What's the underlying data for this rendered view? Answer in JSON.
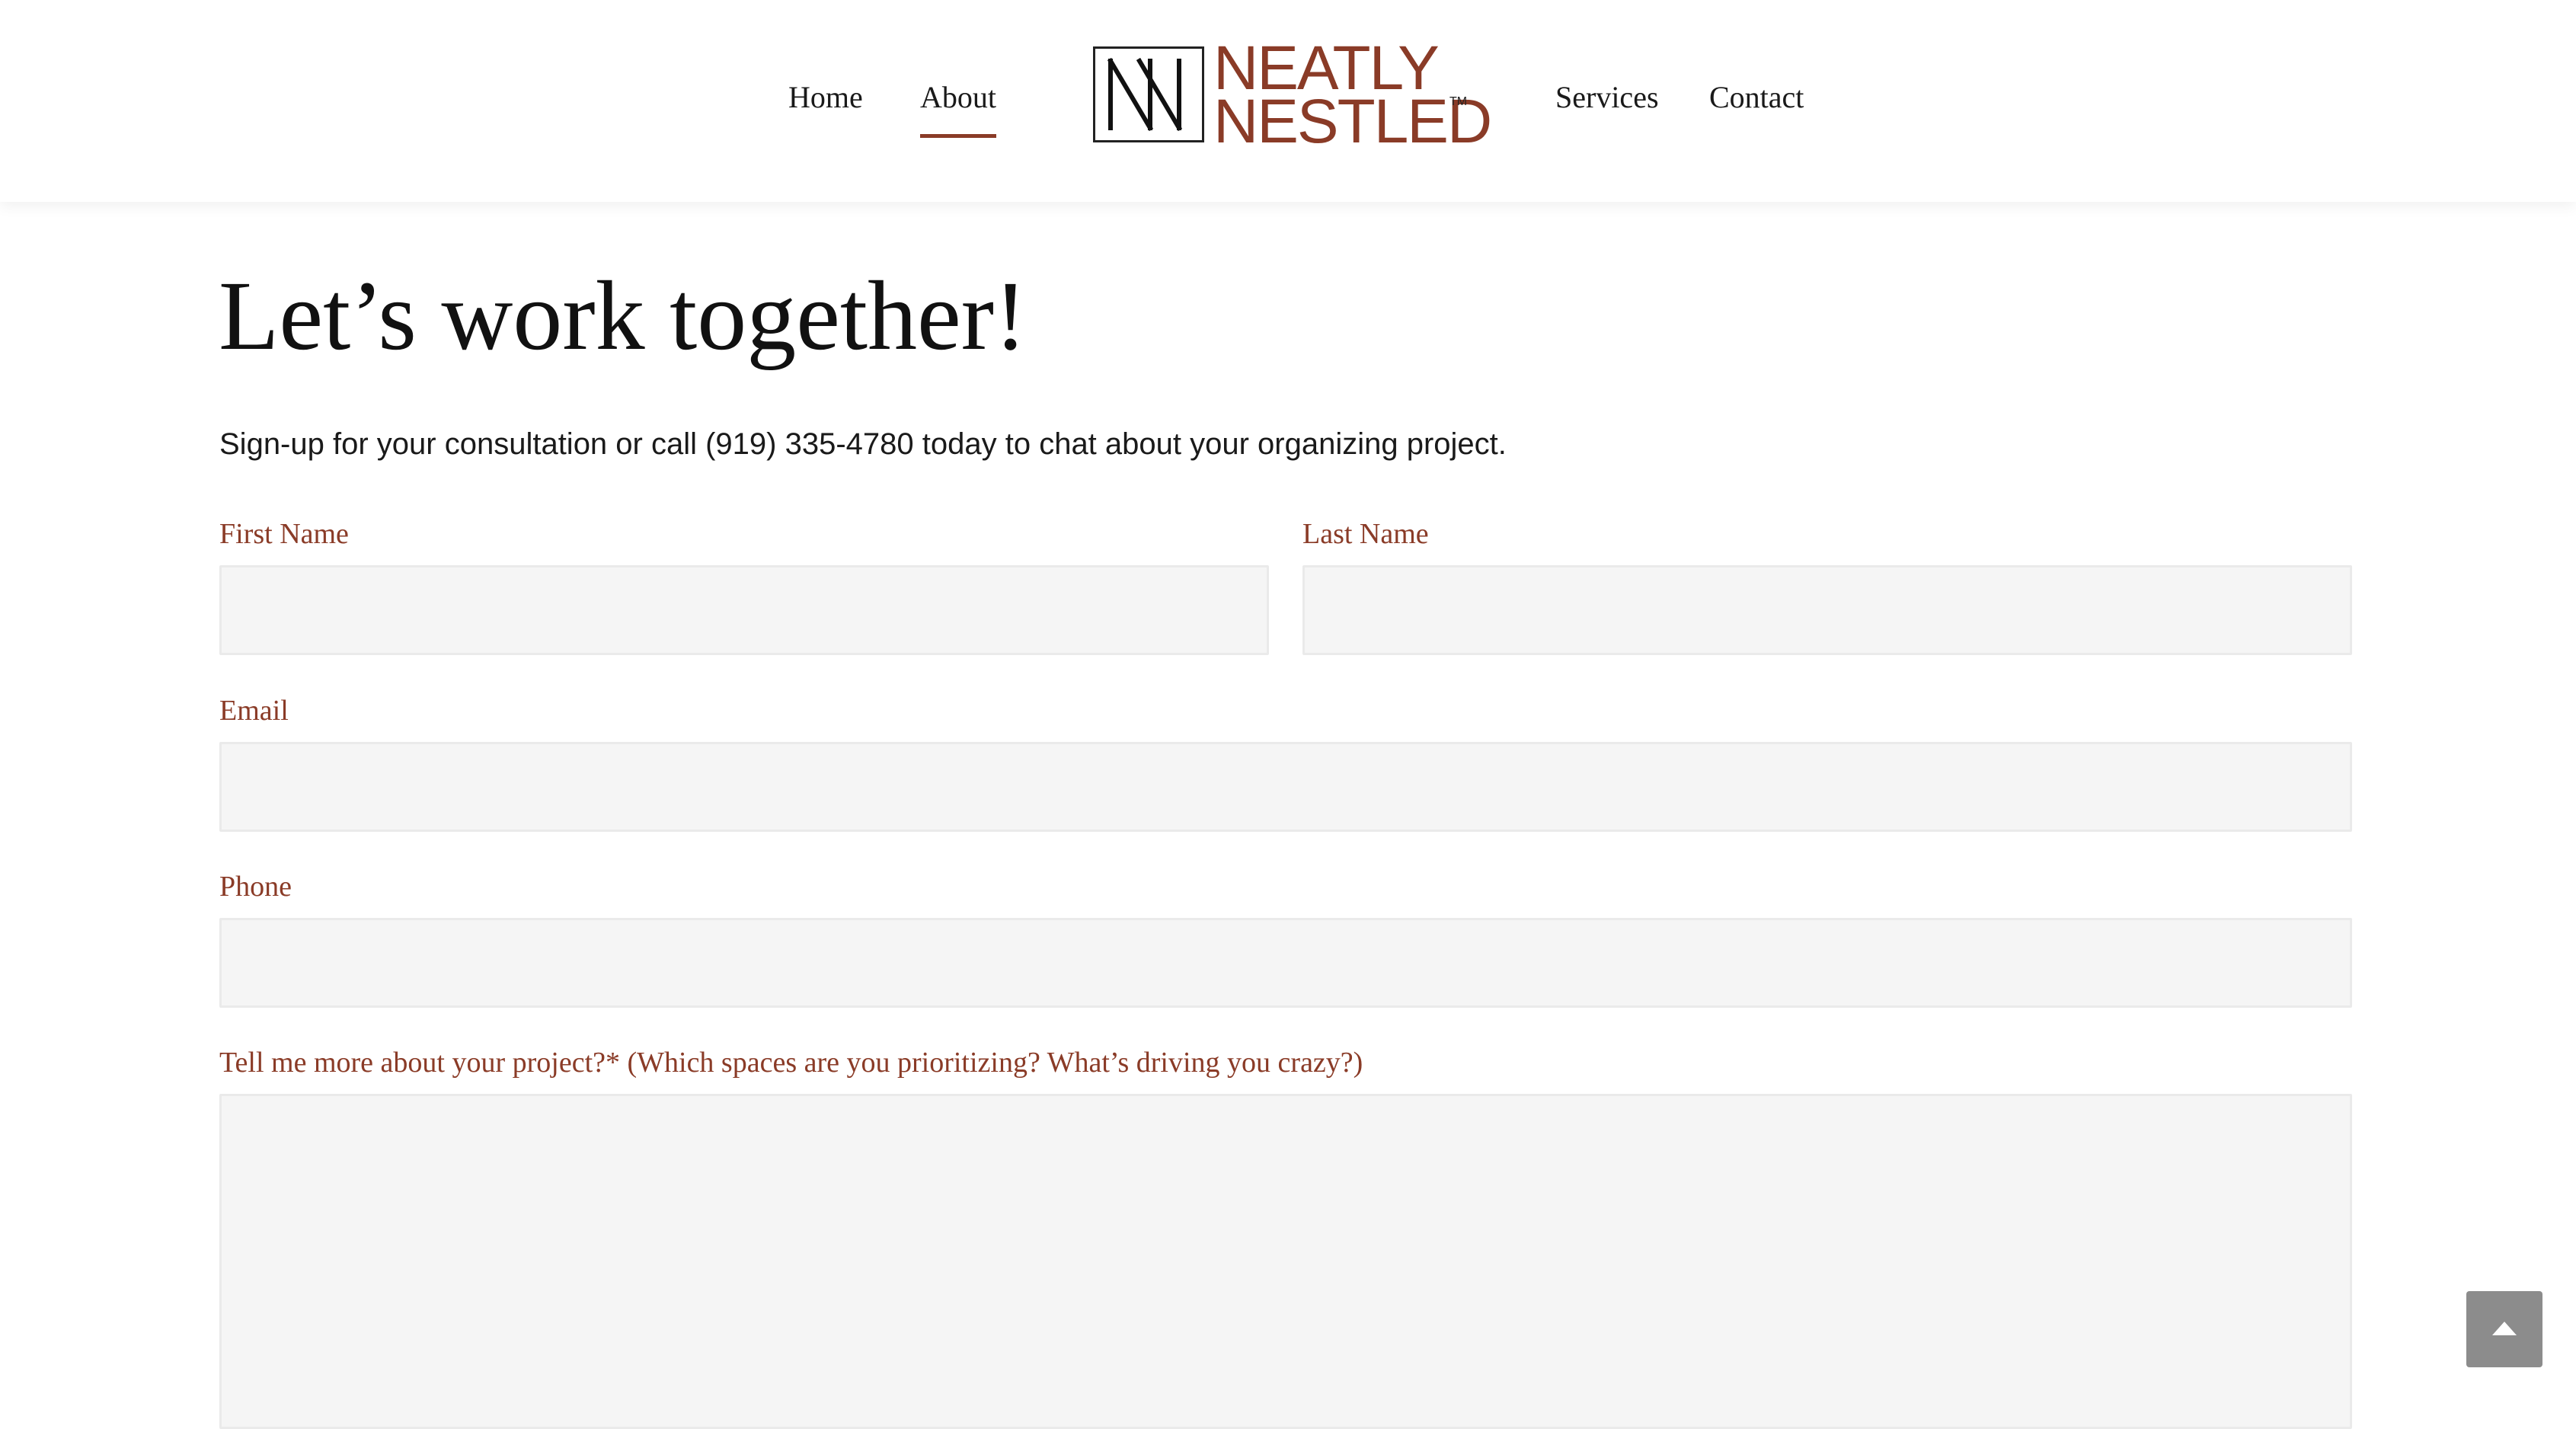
{
  "nav": {
    "items": [
      {
        "label": "Home"
      },
      {
        "label": "About",
        "active": true
      },
      {
        "label": "Services"
      },
      {
        "label": "Contact"
      }
    ],
    "accent_color": "#8a3b27"
  },
  "logo": {
    "line1": "NEATLY",
    "line2": "NESTLED",
    "tm": "TM",
    "brand_color": "#8a3b27"
  },
  "hero": {
    "title": "Let’s work together!",
    "intro": "Sign-up for your consultation or call (919) 335-4780 today to chat about your organizing project."
  },
  "form": {
    "first_name": {
      "label": "First Name",
      "value": ""
    },
    "last_name": {
      "label": "Last Name",
      "value": ""
    },
    "email": {
      "label": "Email",
      "value": ""
    },
    "phone": {
      "label": "Phone",
      "value": ""
    },
    "project": {
      "label": "Tell me more about your project?* (Which spaces are you prioritizing? What’s driving you crazy?)",
      "value": ""
    }
  },
  "back_to_top": {
    "icon": "chevron-up-icon"
  }
}
